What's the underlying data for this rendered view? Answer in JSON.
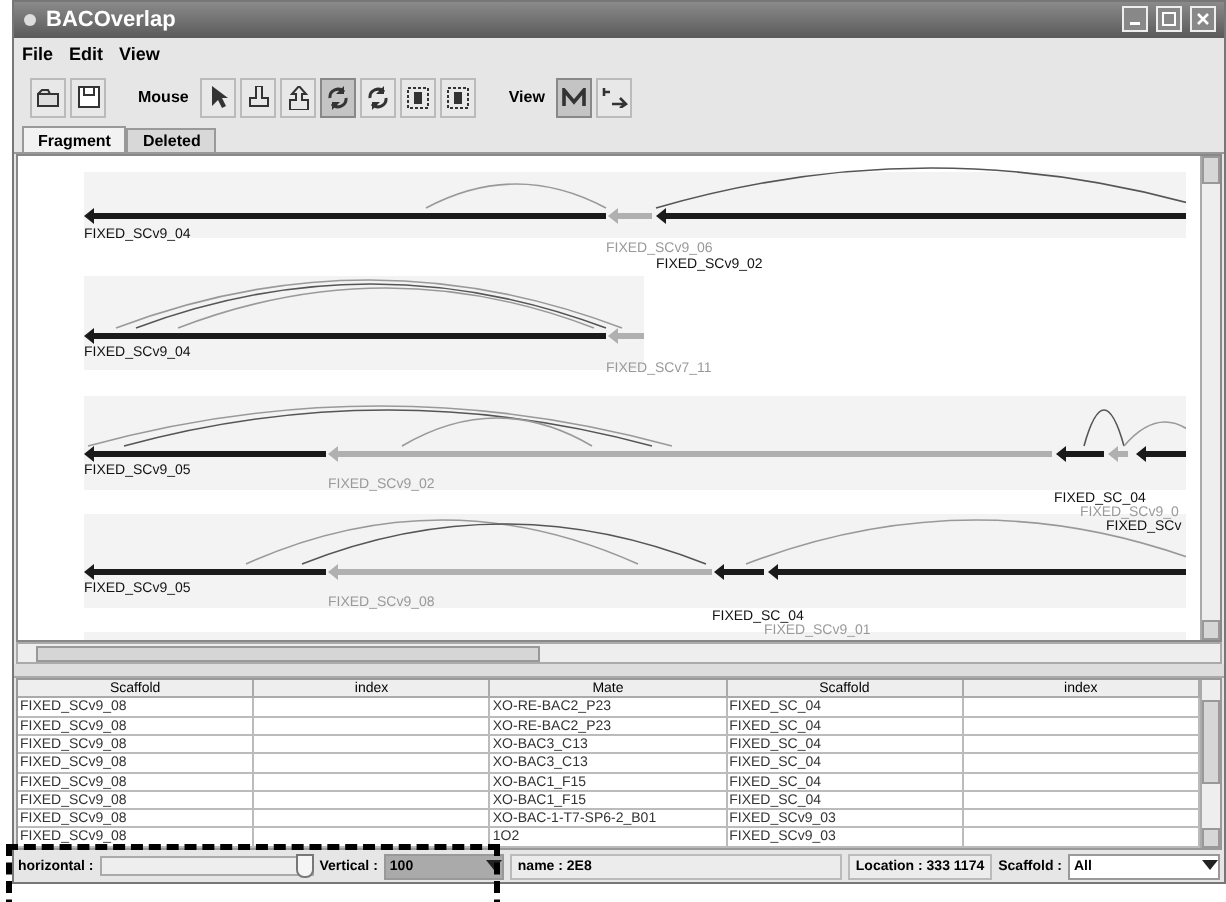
{
  "window": {
    "title": "BACOverlap"
  },
  "menu": [
    "File",
    "Edit",
    "View"
  ],
  "toolbar": {
    "mouse_label": "Mouse",
    "view_label": "View",
    "mouse_tools": [
      {
        "kind": "pointer",
        "selected": false
      },
      {
        "kind": "stamp",
        "selected": false
      },
      {
        "kind": "lift",
        "selected": false
      },
      {
        "kind": "rotate",
        "selected": true
      },
      {
        "kind": "rotate",
        "selected": false
      },
      {
        "kind": "frame",
        "selected": false
      },
      {
        "kind": "frame",
        "selected": false
      }
    ],
    "view_tools": [
      {
        "kind": "m",
        "selected": true
      },
      {
        "kind": "xy",
        "selected": false
      }
    ]
  },
  "tabs": [
    {
      "label": "Fragment",
      "selected": true
    },
    {
      "label": "Deleted",
      "selected": false
    }
  ],
  "tracks": [
    {
      "labels": [
        {
          "text": "FIXED_SCv9_04",
          "kind": "dark"
        },
        {
          "text": "FIXED_SCv9_06",
          "kind": "faded"
        },
        {
          "text": "FIXED_SCv9_02",
          "kind": "dark"
        }
      ]
    },
    {
      "labels": [
        {
          "text": "FIXED_SCv9_04",
          "kind": "dark"
        },
        {
          "text": "FIXED_SCv7_11",
          "kind": "faded"
        }
      ]
    },
    {
      "labels": [
        {
          "text": "FIXED_SCv9_05",
          "kind": "dark"
        },
        {
          "text": "FIXED_SCv9_02",
          "kind": "faded"
        },
        {
          "text": "FIXED_SC_04",
          "kind": "dark"
        },
        {
          "text": "FIXED_SCv9_0",
          "kind": "faded"
        },
        {
          "text": "FIXED_SCv",
          "kind": "dark"
        }
      ]
    },
    {
      "labels": [
        {
          "text": "FIXED_SCv9_05",
          "kind": "dark"
        },
        {
          "text": "FIXED_SCv9_08",
          "kind": "faded"
        },
        {
          "text": "FIXED_SC_04",
          "kind": "dark"
        },
        {
          "text": "FIXED_SCv9_01",
          "kind": "faded"
        }
      ]
    }
  ],
  "table": {
    "columns": [
      "Scaffold",
      "index",
      "Mate",
      "Scaffold",
      "index"
    ],
    "rows": [
      [
        "FIXED_SCv9_08",
        "",
        "XO-RE-BAC2_P23",
        "FIXED_SC_04",
        ""
      ],
      [
        "FIXED_SCv9_08",
        "",
        "XO-RE-BAC2_P23",
        "FIXED_SC_04",
        ""
      ],
      [
        "FIXED_SCv9_08",
        "",
        "XO-BAC3_C13",
        "FIXED_SC_04",
        ""
      ],
      [
        "FIXED_SCv9_08",
        "",
        "XO-BAC3_C13",
        "FIXED_SC_04",
        ""
      ],
      [
        "FIXED_SCv9_08",
        "",
        "XO-BAC1_F15",
        "FIXED_SC_04",
        ""
      ],
      [
        "FIXED_SCv9_08",
        "",
        "XO-BAC1_F15",
        "FIXED_SC_04",
        ""
      ],
      [
        "FIXED_SCv9_08",
        "",
        "XO-BAC-1-T7-SP6-2_B01",
        "FIXED_SCv9_03",
        ""
      ],
      [
        "FIXED_SCv9_08",
        "",
        "1O2",
        "FIXED_SCv9_03",
        ""
      ]
    ]
  },
  "status_bar": {
    "horizontal": {
      "label": "horizontal :",
      "level": 1
    },
    "vertical_label": "Vertical :",
    "vertical_value": "100",
    "name": "name : 2E8",
    "location": "Location : 333 1174",
    "scaffold_label": "Scaffold :",
    "scaffold_value": "All"
  }
}
